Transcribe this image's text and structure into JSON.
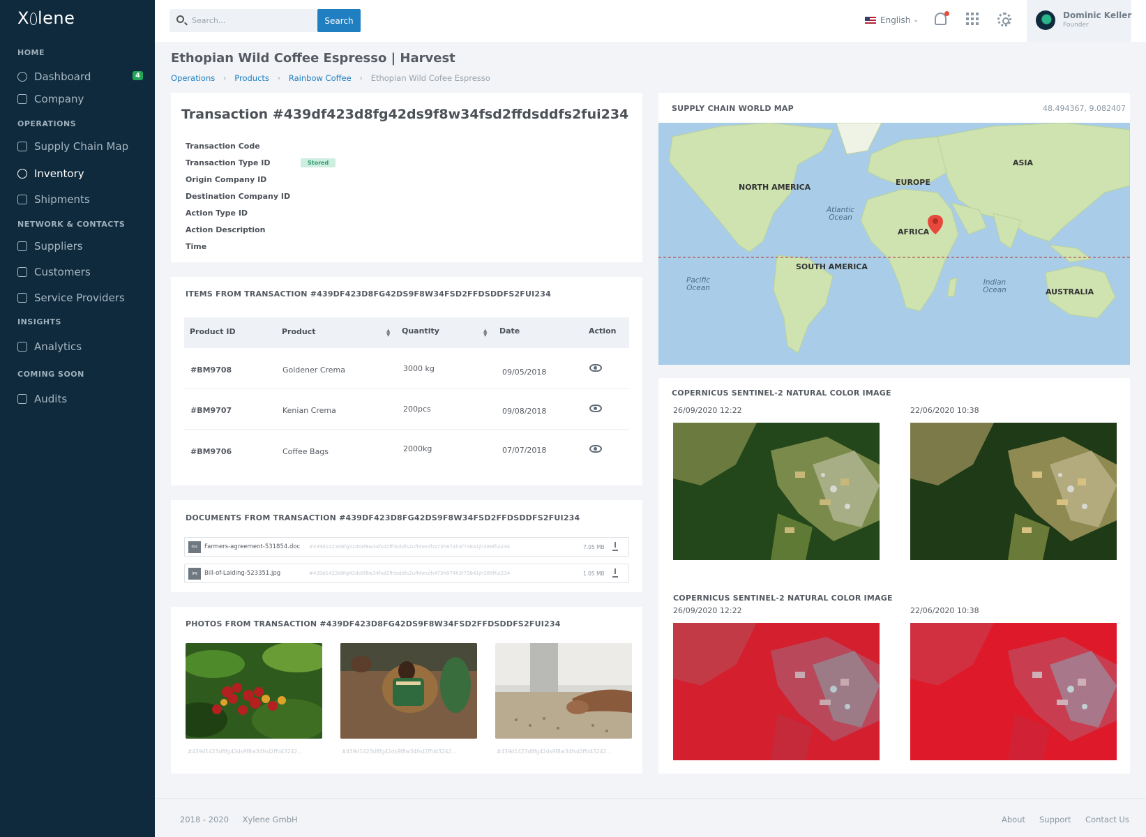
{
  "brand": {
    "logo": "Xylene"
  },
  "sidebar": {
    "sections": [
      "HOME",
      "OPERATIONS",
      "NETWORK & CONTACTS",
      "INSIGHTS",
      "COMING SOON"
    ],
    "items": [
      {
        "label": "Dashboard",
        "badge": "4",
        "icon": "globe-icon"
      },
      {
        "label": "Company",
        "icon": "home-icon"
      },
      {
        "label": "Supply Chain Map",
        "icon": "calendar-icon"
      },
      {
        "label": "Inventory",
        "icon": "globe-icon"
      },
      {
        "label": "Shipments",
        "icon": "calendar-icon"
      },
      {
        "label": "Suppliers",
        "icon": "chat-icon"
      },
      {
        "label": "Customers",
        "icon": "store-icon"
      },
      {
        "label": "Service Providers",
        "icon": "mail-icon"
      },
      {
        "label": "Analytics",
        "icon": "box-icon"
      },
      {
        "label": "Audits",
        "icon": "box-icon"
      }
    ],
    "active": "Inventory"
  },
  "topbar": {
    "search_placeholder": "Search...",
    "search_button": "Search",
    "language": "English",
    "user_name": "Dominic Keller",
    "user_role": "Founder"
  },
  "page": {
    "title": "Ethopian Wild Coffee Espresso | Harvest",
    "breadcrumb": [
      "Operations",
      "Products",
      "Rainbow Coffee",
      "Ethopian Wild Cofee Espresso"
    ]
  },
  "transaction": {
    "title": "Transaction #439df423d8fg42ds9f8w34fsd2ffdsddfs2fui234",
    "fields": [
      "Transaction Code",
      "Transaction Type ID",
      "Origin Company ID",
      "Destination Company ID",
      "Action Type ID",
      "Action Description",
      "Time"
    ],
    "type_badge": "Stored"
  },
  "items": {
    "title": "ITEMS FROM TRANSACTION #439DF423D8FG42DS9F8W34FSD2FFDSDDFS2FUI234",
    "columns": [
      "Product ID",
      "Product",
      "Quantity",
      "Date",
      "Action"
    ],
    "rows": [
      {
        "id": "#BM9708",
        "product": "Goldener Crema",
        "quantity": "3000 kg",
        "date": "09/05/2018"
      },
      {
        "id": "#BM9707",
        "product": "Kenian Crema",
        "quantity": "200pcs",
        "date": "09/08/2018"
      },
      {
        "id": "#BM9706",
        "product": "Coffee Bags",
        "quantity": "2000kg",
        "date": "07/07/2018"
      }
    ]
  },
  "documents": {
    "title": "DOCUMENTS FROM TRANSACTION #439DF423D8FG42DS9F8W34FSD2FFDSDDFS2FUI234",
    "files": [
      {
        "type": "doc",
        "name": "Farmers-agreement-531854.doc",
        "hash": "#439d1423d8fg42ds9f8w34fsd2ffdsddfs2ufhheufh473h874h3f73841jh389ffui234",
        "size": "7.05 MB"
      },
      {
        "type": "jpg",
        "name": "Bill-of-Laiding-523351.jpg",
        "hash": "#439d1423d8fg42ds9f8w34fsd2ffdsddfs2ufhheufh473h874h3f73841jh389ffui234",
        "size": "1.05 MB"
      }
    ]
  },
  "photos": {
    "title": "PHOTOS FROM TRANSACTION #439DF423D8FG42DS9F8W34FSD2FFDSDDFS2FUI234",
    "hashes": [
      "#439d1423d8fg42ds9f8w34fsd2ffd43242...",
      "#439d1423d8fg42ds9f8w34fsd2ffd43242...",
      "#439d1423d8fg42ds9f8w34fsd2ffd43242..."
    ]
  },
  "map": {
    "title": "SUPPLY CHAIN WORLD MAP",
    "coords": "48.494367, 9.082407",
    "continents": [
      "NORTH AMERICA",
      "EUROPE",
      "ASIA",
      "AFRICA",
      "SOUTH AMERICA",
      "AUSTRALIA"
    ],
    "oceans": [
      "Atlantic Ocean",
      "Pacific Ocean",
      "Indian Ocean"
    ]
  },
  "satellite": [
    {
      "title": "COPERNICUS SENTINEL-2 NATURAL COLOR IMAGE",
      "dates": [
        "26/09/2020 12:22",
        "22/06/2020 10:38"
      ]
    },
    {
      "title": "COPERNICUS SENTINEL-2 NATURAL COLOR IMAGE",
      "dates": [
        "26/09/2020 12:22",
        "22/06/2020 10:38"
      ]
    }
  ],
  "footer": {
    "years": "2018 - 2020",
    "company": "Xylene GmbH",
    "links": [
      "About",
      "Support",
      "Contact Us"
    ]
  }
}
